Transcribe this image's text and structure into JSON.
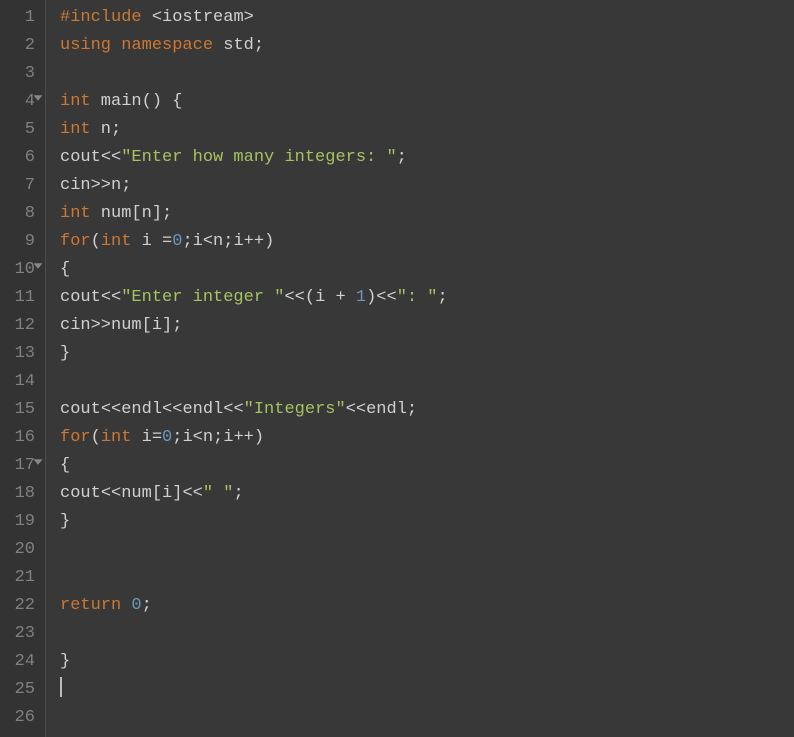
{
  "gutter": {
    "lines": [
      "1",
      "2",
      "3",
      "4",
      "5",
      "6",
      "7",
      "8",
      "9",
      "10",
      "11",
      "12",
      "13",
      "14",
      "15",
      "16",
      "17",
      "18",
      "19",
      "20",
      "21",
      "22",
      "23",
      "24",
      "25",
      "26"
    ],
    "fold_lines": [
      4,
      10,
      17
    ]
  },
  "code": {
    "1": {
      "tokens": [
        {
          "c": "tok-preproc",
          "t": "#include "
        },
        {
          "c": "tok-angle",
          "t": "<"
        },
        {
          "c": "tok-ident",
          "t": "iostream"
        },
        {
          "c": "tok-angle",
          "t": ">"
        }
      ]
    },
    "2": {
      "tokens": [
        {
          "c": "tok-kw",
          "t": "using"
        },
        {
          "c": "tok-ident",
          "t": " "
        },
        {
          "c": "tok-kw",
          "t": "namespace"
        },
        {
          "c": "tok-ident",
          "t": " std"
        },
        {
          "c": "tok-punc",
          "t": ";"
        }
      ]
    },
    "3": {
      "tokens": []
    },
    "4": {
      "tokens": [
        {
          "c": "tok-type",
          "t": "int"
        },
        {
          "c": "tok-ident",
          "t": " main"
        },
        {
          "c": "tok-punc",
          "t": "()"
        },
        {
          "c": "tok-ident",
          "t": " "
        },
        {
          "c": "tok-brace",
          "t": "{"
        }
      ]
    },
    "5": {
      "tokens": [
        {
          "c": "tok-type",
          "t": "int"
        },
        {
          "c": "tok-ident",
          "t": " n"
        },
        {
          "c": "tok-punc",
          "t": ";"
        }
      ]
    },
    "6": {
      "tokens": [
        {
          "c": "tok-ident",
          "t": "cout"
        },
        {
          "c": "tok-op",
          "t": "<<"
        },
        {
          "c": "tok-string",
          "t": "\"Enter how many integers: \""
        },
        {
          "c": "tok-punc",
          "t": ";"
        }
      ]
    },
    "7": {
      "tokens": [
        {
          "c": "tok-ident",
          "t": "cin"
        },
        {
          "c": "tok-op",
          "t": ">>"
        },
        {
          "c": "tok-ident",
          "t": "n"
        },
        {
          "c": "tok-punc",
          "t": ";"
        }
      ]
    },
    "8": {
      "tokens": [
        {
          "c": "tok-type",
          "t": "int"
        },
        {
          "c": "tok-ident",
          "t": " num"
        },
        {
          "c": "tok-punc",
          "t": "["
        },
        {
          "c": "tok-ident",
          "t": "n"
        },
        {
          "c": "tok-punc",
          "t": "]"
        },
        {
          "c": "tok-punc",
          "t": ";"
        }
      ]
    },
    "9": {
      "tokens": [
        {
          "c": "tok-kw",
          "t": "for"
        },
        {
          "c": "tok-punc",
          "t": "("
        },
        {
          "c": "tok-type",
          "t": "int"
        },
        {
          "c": "tok-ident",
          "t": " i "
        },
        {
          "c": "tok-op",
          "t": "="
        },
        {
          "c": "tok-num",
          "t": "0"
        },
        {
          "c": "tok-punc",
          "t": ";"
        },
        {
          "c": "tok-ident",
          "t": "i"
        },
        {
          "c": "tok-op",
          "t": "<"
        },
        {
          "c": "tok-ident",
          "t": "n"
        },
        {
          "c": "tok-punc",
          "t": ";"
        },
        {
          "c": "tok-ident",
          "t": "i"
        },
        {
          "c": "tok-op",
          "t": "++"
        },
        {
          "c": "tok-punc",
          "t": ")"
        }
      ]
    },
    "10": {
      "tokens": [
        {
          "c": "tok-brace",
          "t": "{"
        }
      ]
    },
    "11": {
      "tokens": [
        {
          "c": "tok-ident",
          "t": "cout"
        },
        {
          "c": "tok-op",
          "t": "<<"
        },
        {
          "c": "tok-string",
          "t": "\"Enter integer \""
        },
        {
          "c": "tok-op",
          "t": "<<"
        },
        {
          "c": "tok-punc",
          "t": "("
        },
        {
          "c": "tok-ident",
          "t": "i "
        },
        {
          "c": "tok-op",
          "t": "+"
        },
        {
          "c": "tok-ident",
          "t": " "
        },
        {
          "c": "tok-num",
          "t": "1"
        },
        {
          "c": "tok-punc",
          "t": ")"
        },
        {
          "c": "tok-op",
          "t": "<<"
        },
        {
          "c": "tok-string",
          "t": "\": \""
        },
        {
          "c": "tok-punc",
          "t": ";"
        }
      ]
    },
    "12": {
      "tokens": [
        {
          "c": "tok-ident",
          "t": "cin"
        },
        {
          "c": "tok-op",
          "t": ">>"
        },
        {
          "c": "tok-ident",
          "t": "num"
        },
        {
          "c": "tok-punc",
          "t": "["
        },
        {
          "c": "tok-ident",
          "t": "i"
        },
        {
          "c": "tok-punc",
          "t": "]"
        },
        {
          "c": "tok-punc",
          "t": ";"
        }
      ]
    },
    "13": {
      "tokens": [
        {
          "c": "tok-brace",
          "t": "}"
        }
      ]
    },
    "14": {
      "tokens": []
    },
    "15": {
      "tokens": [
        {
          "c": "tok-ident",
          "t": "cout"
        },
        {
          "c": "tok-op",
          "t": "<<"
        },
        {
          "c": "tok-ident",
          "t": "endl"
        },
        {
          "c": "tok-op",
          "t": "<<"
        },
        {
          "c": "tok-ident",
          "t": "endl"
        },
        {
          "c": "tok-op",
          "t": "<<"
        },
        {
          "c": "tok-string",
          "t": "\"Integers\""
        },
        {
          "c": "tok-op",
          "t": "<<"
        },
        {
          "c": "tok-ident",
          "t": "endl"
        },
        {
          "c": "tok-punc",
          "t": ";"
        }
      ]
    },
    "16": {
      "tokens": [
        {
          "c": "tok-kw",
          "t": "for"
        },
        {
          "c": "tok-punc",
          "t": "("
        },
        {
          "c": "tok-type",
          "t": "int"
        },
        {
          "c": "tok-ident",
          "t": " i"
        },
        {
          "c": "tok-op",
          "t": "="
        },
        {
          "c": "tok-num",
          "t": "0"
        },
        {
          "c": "tok-punc",
          "t": ";"
        },
        {
          "c": "tok-ident",
          "t": "i"
        },
        {
          "c": "tok-op",
          "t": "<"
        },
        {
          "c": "tok-ident",
          "t": "n"
        },
        {
          "c": "tok-punc",
          "t": ";"
        },
        {
          "c": "tok-ident",
          "t": "i"
        },
        {
          "c": "tok-op",
          "t": "++"
        },
        {
          "c": "tok-punc",
          "t": ")"
        }
      ]
    },
    "17": {
      "tokens": [
        {
          "c": "tok-brace",
          "t": "{"
        }
      ]
    },
    "18": {
      "tokens": [
        {
          "c": "tok-ident",
          "t": "cout"
        },
        {
          "c": "tok-op",
          "t": "<<"
        },
        {
          "c": "tok-ident",
          "t": "num"
        },
        {
          "c": "tok-punc",
          "t": "["
        },
        {
          "c": "tok-ident",
          "t": "i"
        },
        {
          "c": "tok-punc",
          "t": "]"
        },
        {
          "c": "tok-op",
          "t": "<<"
        },
        {
          "c": "tok-string",
          "t": "\" \""
        },
        {
          "c": "tok-punc",
          "t": ";"
        }
      ]
    },
    "19": {
      "tokens": [
        {
          "c": "tok-brace",
          "t": "}"
        }
      ]
    },
    "20": {
      "tokens": []
    },
    "21": {
      "tokens": []
    },
    "22": {
      "tokens": [
        {
          "c": "tok-kw",
          "t": "return"
        },
        {
          "c": "tok-ident",
          "t": " "
        },
        {
          "c": "tok-num",
          "t": "0"
        },
        {
          "c": "tok-punc",
          "t": ";"
        }
      ]
    },
    "23": {
      "tokens": []
    },
    "24": {
      "tokens": [
        {
          "c": "tok-brace",
          "t": "}"
        }
      ]
    },
    "25": {
      "tokens": [],
      "cursor": true
    },
    "26": {
      "tokens": []
    }
  }
}
